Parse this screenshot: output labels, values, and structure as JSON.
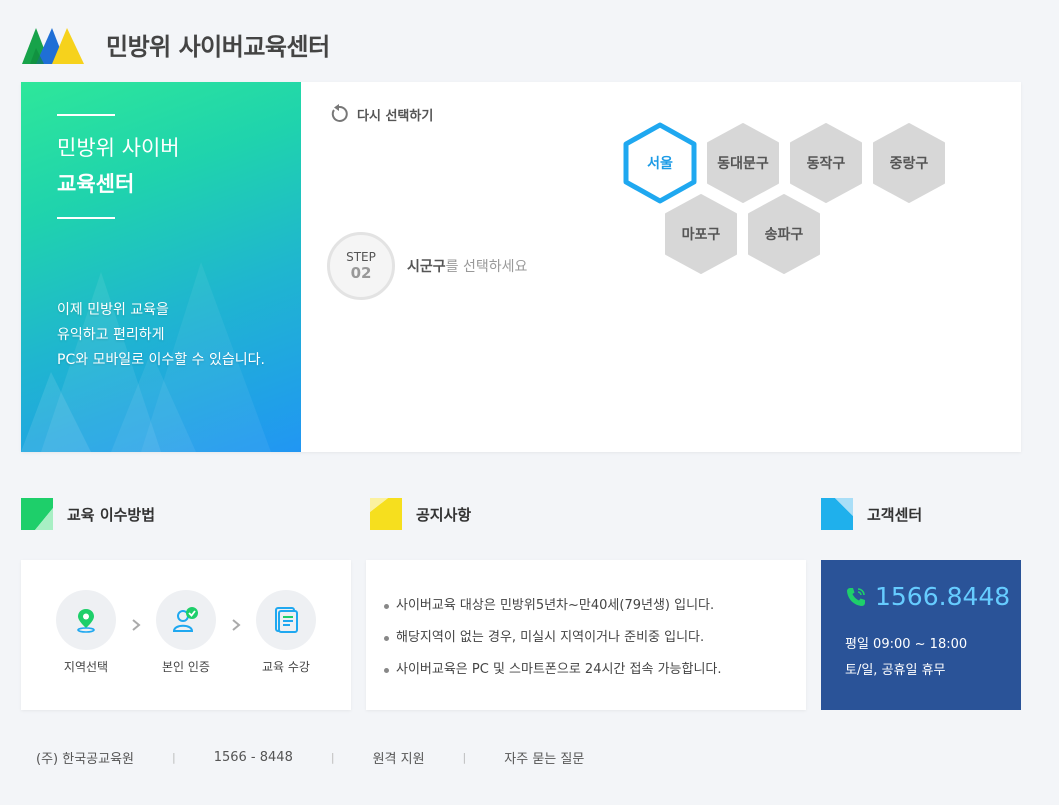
{
  "header": {
    "title": "민방위 사이버교육센터"
  },
  "promo": {
    "title_line1": "민방위 사이버",
    "title_line2": "교육센터",
    "desc_line1": "이제 민방위 교육을",
    "desc_line2": "유익하고 편리하게",
    "desc_line3": "PC와 모바일로 이수할 수 있습니다."
  },
  "selector": {
    "reset_label": "다시 선택하기",
    "step_label": "STEP",
    "step_number": "02",
    "instruction_em": "시군구",
    "instruction_rest": "를 선택하세요",
    "regions": [
      {
        "label": "서울",
        "active": true
      },
      {
        "label": "동대문구",
        "active": false
      },
      {
        "label": "동작구",
        "active": false
      },
      {
        "label": "중랑구",
        "active": false
      },
      {
        "label": "마포구",
        "active": false
      },
      {
        "label": "송파구",
        "active": false
      }
    ]
  },
  "sections": {
    "method_title": "교육 이수방법",
    "notice_title": "공지사항",
    "support_title": "고객센터"
  },
  "method": {
    "steps": [
      {
        "label": "지역선택",
        "icon": "location-pin-icon"
      },
      {
        "label": "본인 인증",
        "icon": "user-check-icon"
      },
      {
        "label": "교육 수강",
        "icon": "document-icon"
      }
    ]
  },
  "notices": [
    "사이버교육 대상은 민방위5년차~만40세(79년생) 입니다.",
    "해당지역이 없는 경우, 미실시 지역이거나 준비중 입니다.",
    "사이버교육은 PC 및 스마트폰으로 24시간 접속 가능합니다."
  ],
  "support": {
    "phone": "1566.8448",
    "hours_weekday": "평일 09:00 ~ 18:00",
    "hours_weekend": "토/일, 공휴일 휴무"
  },
  "footer": {
    "company": "(주) 한국공교육원",
    "phone": "1566 - 8448",
    "remote": "원격 지원",
    "faq": "자주 묻는 질문",
    "separator": "|"
  },
  "colors": {
    "accent_blue": "#1fa8f0",
    "support_bg": "#2a5398",
    "phone_text": "#66ccff",
    "hex_inactive": "#d7d7d7"
  }
}
